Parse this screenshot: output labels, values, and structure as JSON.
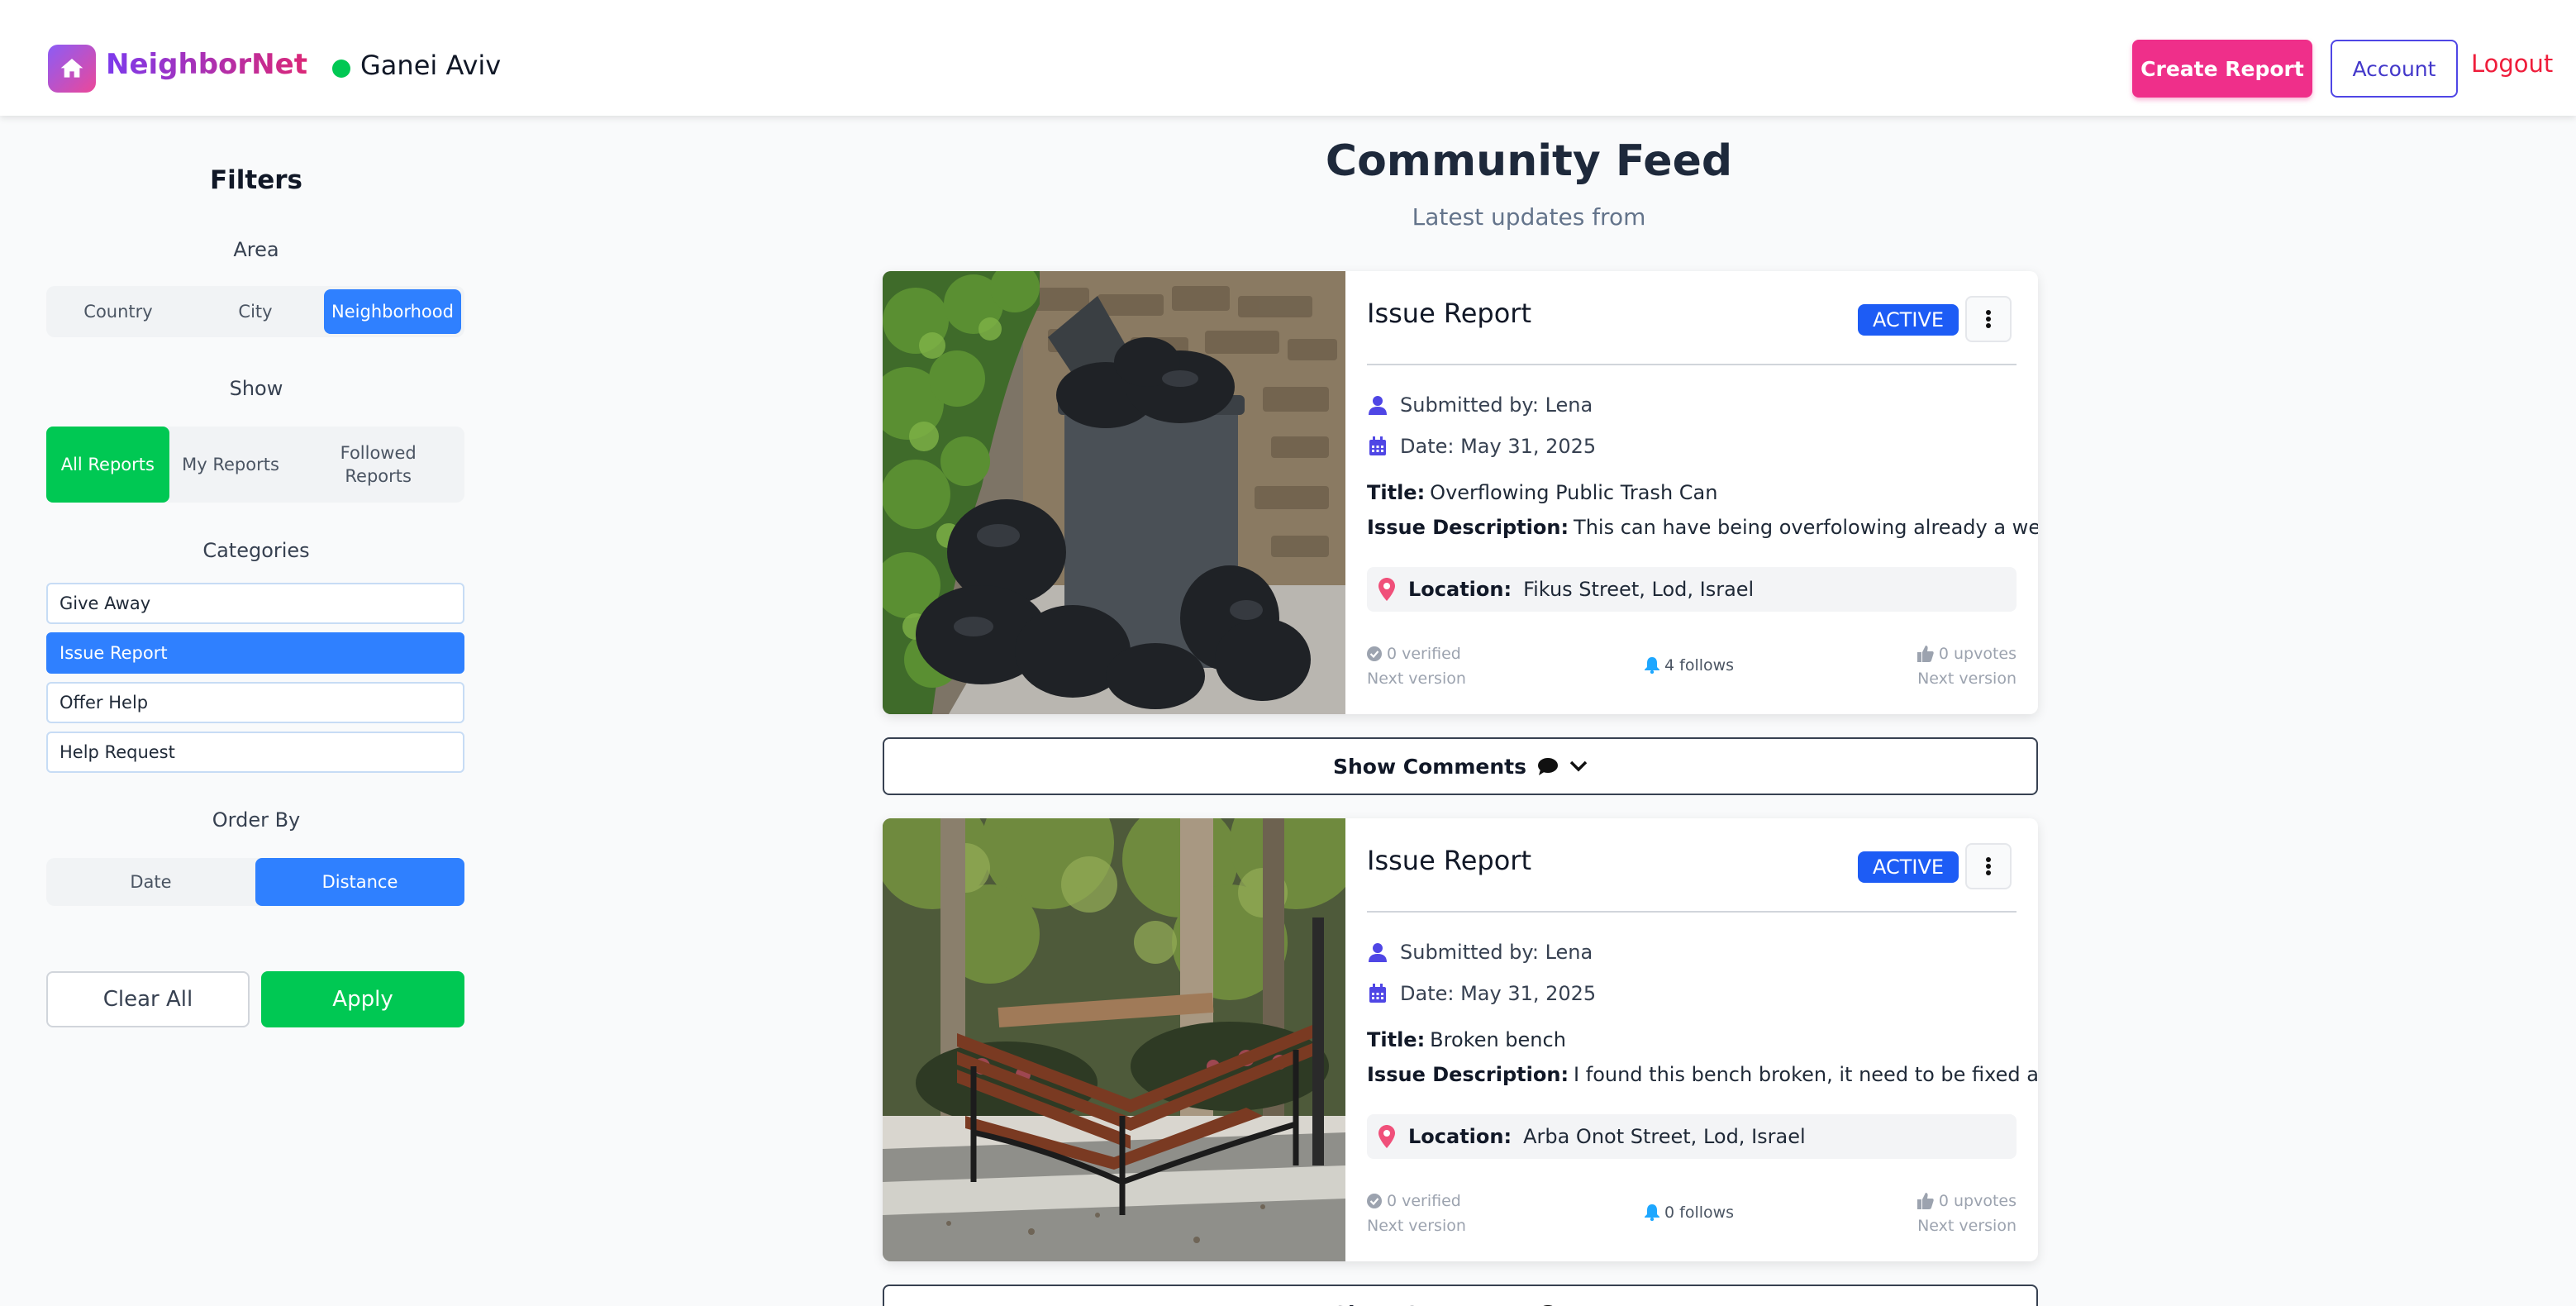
{
  "header": {
    "app_name": "NeighborNet",
    "neighborhood": "Ganei Aviv",
    "create_report": "Create Report",
    "account": "Account",
    "logout": "Logout"
  },
  "sidebar": {
    "title": "Filters",
    "area_label": "Area",
    "area_options": [
      "Country",
      "City",
      "Neighborhood"
    ],
    "area_selected": "Neighborhood",
    "show_label": "Show",
    "show_options": [
      "All Reports",
      "My Reports",
      "Followed Reports"
    ],
    "show_selected": "All Reports",
    "categories_label": "Categories",
    "categories": [
      "Give Away",
      "Issue Report",
      "Offer Help",
      "Help Request"
    ],
    "category_selected": "Issue Report",
    "order_label": "Order By",
    "order_options": [
      "Date",
      "Distance"
    ],
    "order_selected": "Distance",
    "clear_all": "Clear All",
    "apply": "Apply"
  },
  "feed": {
    "title": "Community Feed",
    "subtitle": "Latest updates from",
    "comments_label": "Show Comments",
    "posts": [
      {
        "type": "Issue Report",
        "status": "ACTIVE",
        "submitted_by": "Submitted by: Lena",
        "date": "Date: May 31, 2025",
        "title_label": "Title:",
        "title": "Overflowing Public Trash Can",
        "desc_label": "Issue Description:",
        "description": "This can have being overfolowing already a week!",
        "location_label": "Location:",
        "location": "Fikus Street, Lod, Israel",
        "verified": "0 verified",
        "verified_note": "Next version",
        "follows": "4 follows",
        "upvotes": "0 upvotes",
        "upvotes_note": "Next version"
      },
      {
        "type": "Issue Report",
        "status": "ACTIVE",
        "submitted_by": "Submitted by: Lena",
        "date": "Date: May 31, 2025",
        "title_label": "Title:",
        "title": "Broken bench",
        "desc_label": "Issue Description:",
        "description": "I found this bench broken, it need to be fixed asap!",
        "location_label": "Location:",
        "location": "Arba Onot Street, Lod, Israel",
        "verified": "0 verified",
        "verified_note": "Next version",
        "follows": "0 follows",
        "upvotes": "0 upvotes",
        "upvotes_note": "Next version"
      }
    ]
  },
  "colors": {
    "primary_blue": "#2f80ff",
    "green": "#00c853",
    "pink": "#ef2f8a",
    "indigo": "#4f46e5",
    "logout_red": "#ef1d3b",
    "badge_blue": "#1d5cf5"
  },
  "icons": [
    "home-icon",
    "user-icon",
    "calendar-icon",
    "map-pin-icon",
    "check-circle-icon",
    "bell-icon",
    "thumbs-up-icon",
    "kebab-menu-icon",
    "comment-icon",
    "chevron-down-icon"
  ]
}
